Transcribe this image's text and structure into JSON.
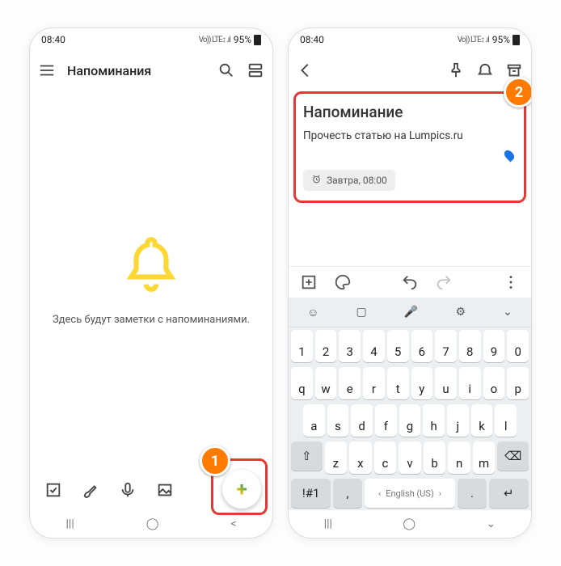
{
  "status": {
    "time": "08:40",
    "net": "Vo)) LTE↕ .ıl",
    "battery": "95%"
  },
  "phone1": {
    "title": "Напоминания",
    "empty": "Здесь будут заметки с напоминаниями."
  },
  "phone2": {
    "note_title": "Напоминание",
    "note_body": "Прочесть статью на Lumpics.ru",
    "chip": "Завтра, 08:00"
  },
  "keyboard": {
    "row1": [
      {
        "k": "1"
      },
      {
        "k": "2"
      },
      {
        "k": "3"
      },
      {
        "k": "4"
      },
      {
        "k": "5"
      },
      {
        "k": "6"
      },
      {
        "k": "7"
      },
      {
        "k": "8"
      },
      {
        "k": "9"
      },
      {
        "k": "0"
      }
    ],
    "row2": [
      {
        "k": "q"
      },
      {
        "k": "w"
      },
      {
        "k": "e"
      },
      {
        "k": "r"
      },
      {
        "k": "t"
      },
      {
        "k": "y"
      },
      {
        "k": "u"
      },
      {
        "k": "i"
      },
      {
        "k": "o"
      },
      {
        "k": "p"
      }
    ],
    "row3": [
      {
        "k": "a"
      },
      {
        "k": "s"
      },
      {
        "k": "d"
      },
      {
        "k": "f"
      },
      {
        "k": "g"
      },
      {
        "k": "h"
      },
      {
        "k": "j"
      },
      {
        "k": "k"
      },
      {
        "k": "l"
      }
    ],
    "row4": [
      {
        "k": "z"
      },
      {
        "k": "x"
      },
      {
        "k": "c"
      },
      {
        "k": "v"
      },
      {
        "k": "b"
      },
      {
        "k": "n"
      },
      {
        "k": "m"
      }
    ],
    "sym": "!#1",
    "comma": ",",
    "space": "English (US)",
    "period": ".",
    "enter": "↵"
  },
  "callouts": {
    "one": "1",
    "two": "2"
  }
}
